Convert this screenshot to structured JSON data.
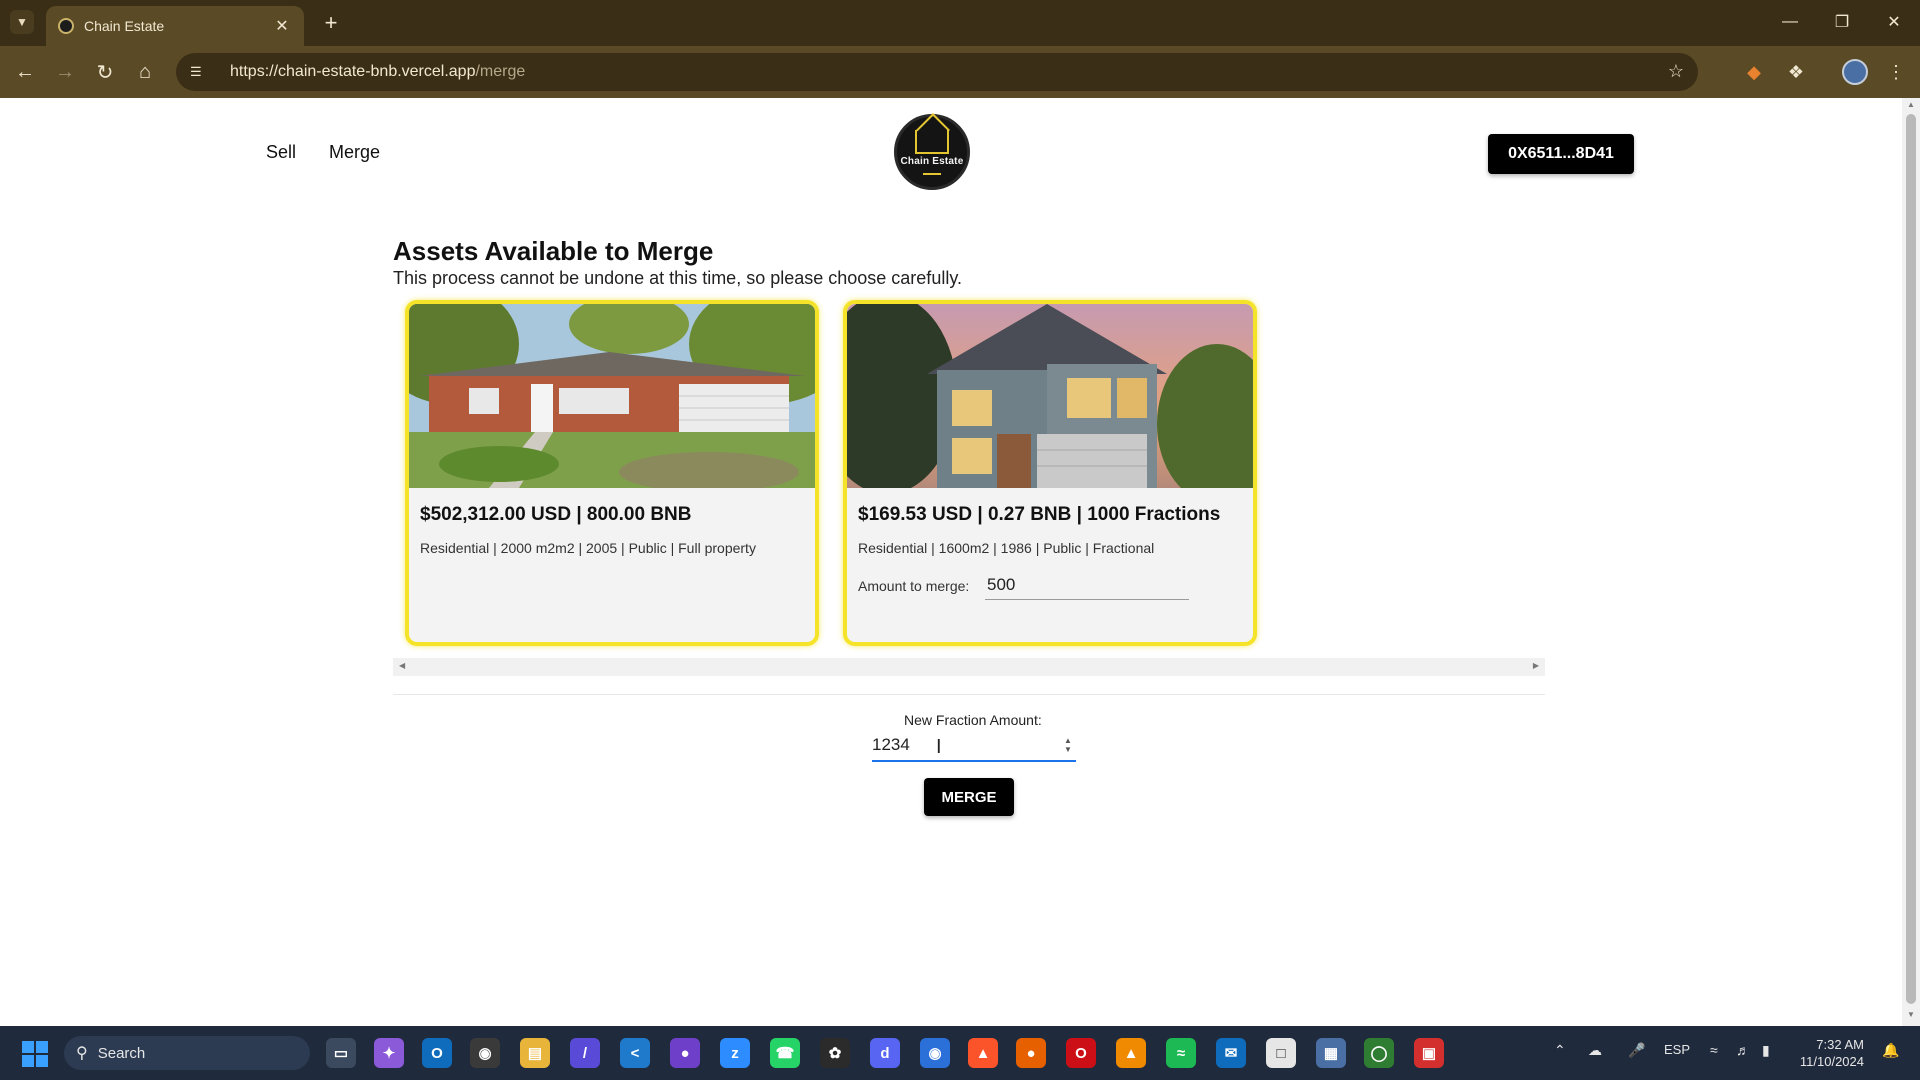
{
  "browser": {
    "tab_title": "Chain Estate",
    "url_host": "https://chain-estate-bnb.vercel.app",
    "url_path": "/merge"
  },
  "nav": {
    "sell": "Sell",
    "merge": "Merge",
    "logo_text": "Chain Estate",
    "wallet": "0X6511...8D41"
  },
  "section": {
    "title": "Assets Available to Merge",
    "subtitle": "This process cannot be undone at this time, so please choose carefully."
  },
  "cards": [
    {
      "price": "$502,312.00 USD | 800.00 BNB",
      "details": "Residential | 2000 m2m2 | 2005 | Public | Full property"
    },
    {
      "price": "$169.53 USD | 0.27 BNB | 1000 Fractions",
      "details": "Residential | 1600m2 | 1986 | Public | Fractional",
      "merge_label": "Amount to merge:",
      "merge_value": "500"
    }
  ],
  "form": {
    "fraction_label": "New Fraction Amount:",
    "fraction_value": "1234",
    "merge_button": "MERGE"
  },
  "taskbar": {
    "search": "Search",
    "language": "ESP",
    "time": "7:32 AM",
    "date": "11/10/2024"
  },
  "colors": {
    "card_border": "#f5e32a",
    "chrome": "#5a4a26",
    "button": "#000000",
    "focus": "#1a73e8"
  }
}
